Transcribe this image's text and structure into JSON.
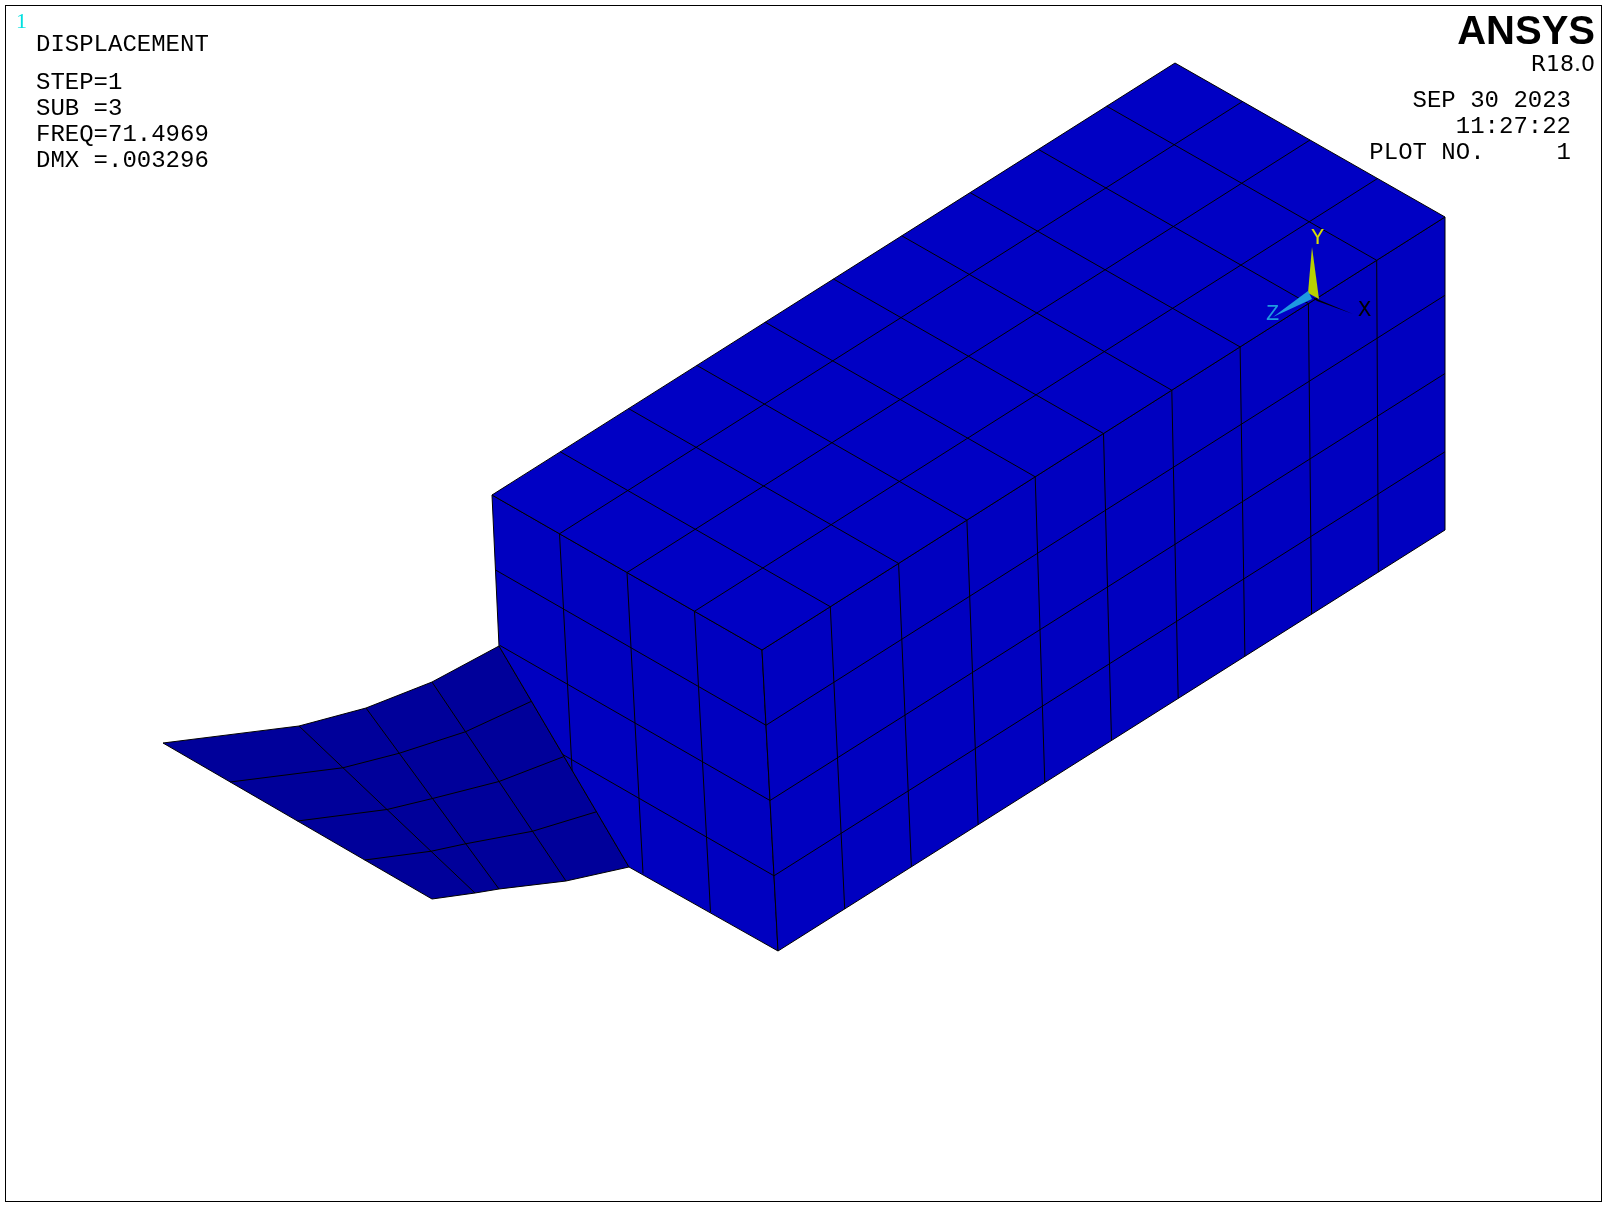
{
  "window_number": "1",
  "legend": {
    "title": "DISPLACEMENT",
    "lines": [
      "STEP=1",
      "SUB =3",
      "FREQ=71.4969",
      "DMX =.003296"
    ]
  },
  "logo": {
    "name": "ANSYS",
    "release": "R18.0"
  },
  "stamp": {
    "date": "SEP 30 2023",
    "time": "11:27:22",
    "plot_number": "PLOT NO.     1"
  },
  "triad": {
    "labels": [
      {
        "kind": "y",
        "text": "Y"
      },
      {
        "kind": "z",
        "text": "Z"
      },
      {
        "kind": "x",
        "text": "X"
      }
    ]
  }
}
